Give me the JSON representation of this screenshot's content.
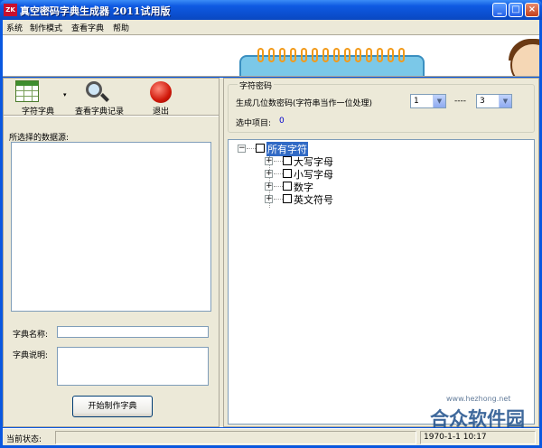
{
  "window": {
    "title": "真空密码字典生成器 2011试用版",
    "icon_text": "ZK",
    "minimize": "_",
    "maximize": "□",
    "close": "×"
  },
  "menu": [
    "系统",
    "制作模式",
    "查看字典",
    "帮助"
  ],
  "toolbar": {
    "dict_label": "字符字典",
    "dropdown_arrow": "▾",
    "view_records_label": "查看字典记录",
    "exit_label": "退出"
  },
  "left": {
    "data_sources_label": "所选择的数据源:",
    "dict_name_label": "字典名称:",
    "dict_name_value": "",
    "dict_desc_label": "字典说明:",
    "dict_desc_value": "",
    "start_button": "开始制作字典"
  },
  "right": {
    "group_title": "字符密码",
    "digits_label": "生成几位数密码(字符串当作一位处理)",
    "min_value": "1",
    "dash": "----",
    "max_value": "3",
    "selected_label": "选中项目:",
    "selected_count": "0",
    "tree": {
      "root": "所有字符",
      "children": [
        "大写字母",
        "小写字母",
        "数字",
        "英文符号"
      ]
    }
  },
  "status": {
    "label": "当前状态:",
    "value": "",
    "datetime": "1970-1-1 10:17"
  },
  "watermark": {
    "main": "合众软件园",
    "sub": "www.hezhong.net"
  },
  "colors": {
    "titlebar": "#0F5AE2",
    "selection": "#316AC5",
    "face": "#ECE9D8"
  }
}
